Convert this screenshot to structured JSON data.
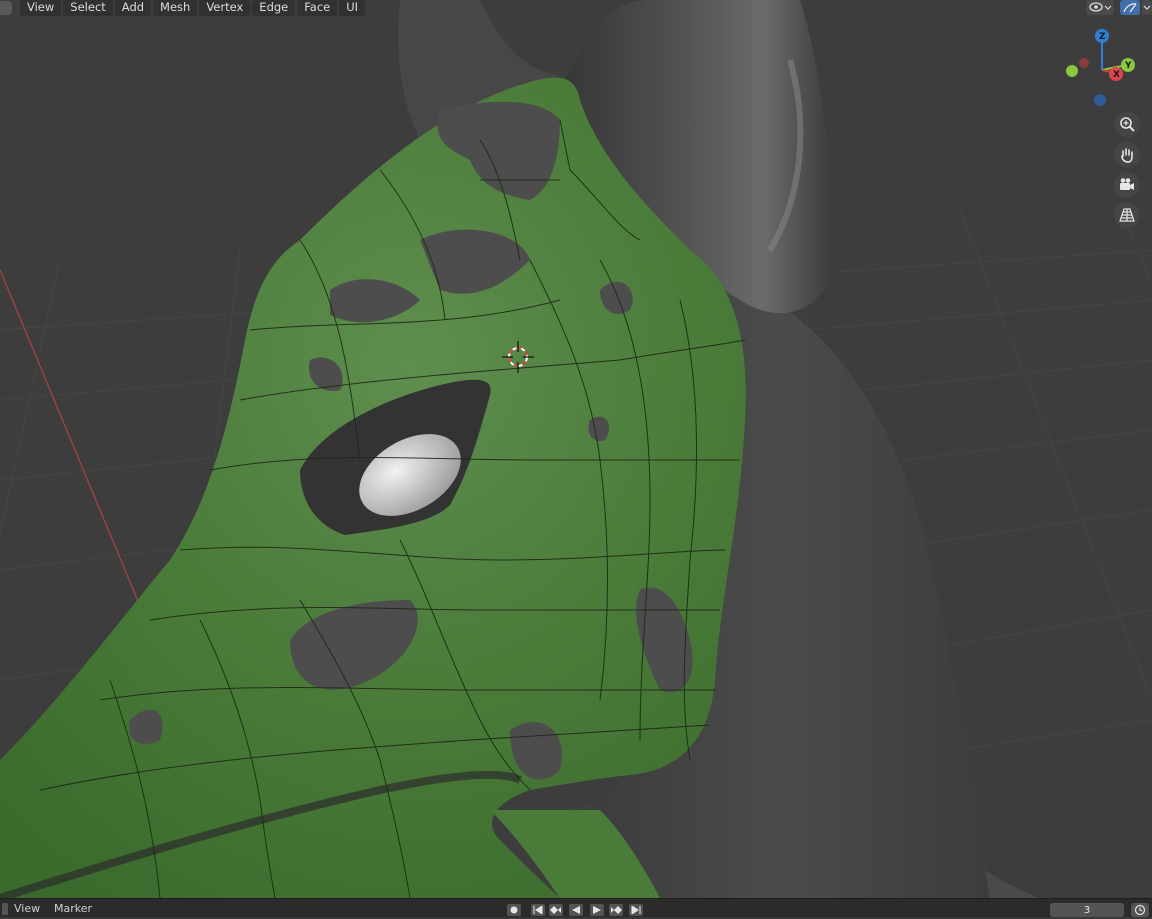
{
  "header": {
    "menus": [
      "View",
      "Select",
      "Add",
      "Mesh",
      "Vertex",
      "Edge",
      "Face",
      "UI"
    ]
  },
  "gizmo": {
    "z_label": "Z",
    "y_label": "Y",
    "x_label": "X"
  },
  "navigation": {
    "icons": [
      "zoom-icon",
      "pan-hand-icon",
      "camera-icon",
      "grid-perspective-icon"
    ]
  },
  "timeline": {
    "menus": [
      "View",
      "Marker"
    ],
    "current_frame": "3"
  },
  "colors": {
    "background": "#3d3d3d",
    "grid": "#444444",
    "mesh_green": "#4a7a3a",
    "mesh_dark": "#3f3f3f",
    "x_axis": "#c8484a",
    "y_axis": "#8ac840",
    "z_axis": "#2f7fd9"
  }
}
